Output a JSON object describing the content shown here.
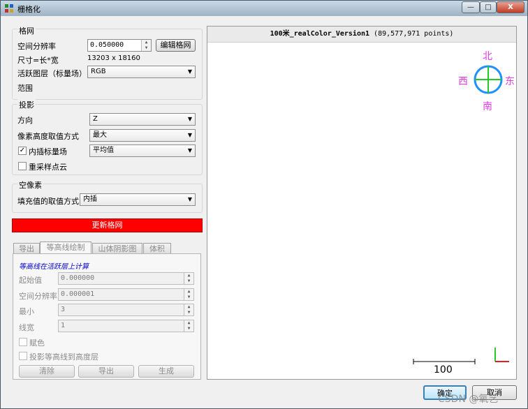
{
  "window": {
    "title": "栅格化",
    "minimize_label": "—",
    "maximize_label": "□",
    "close_label": "X"
  },
  "grid_group": {
    "title": "格网",
    "resolution_label": "空间分辨率",
    "resolution_value": "0.050000",
    "edit_grid_button": "编辑格网",
    "size_label": "尺寸=长*宽",
    "size_value": "13203 x 18160",
    "active_layer_label": "活跃图层（标量场）",
    "active_layer_value": "RGB",
    "range_label": "范围"
  },
  "projection_group": {
    "title": "投影",
    "direction_label": "方向",
    "direction_value": "Z",
    "cell_height_label": "像素高度取值方式",
    "cell_height_value": "最大",
    "interp_sf_label": "内插标量场",
    "interp_sf_checked": true,
    "interp_sf_value": "平均值",
    "resample_label": "重采样点云",
    "resample_checked": false
  },
  "empty_group": {
    "title": "空像素",
    "fill_label": "填充值的取值方式",
    "fill_value": "内插"
  },
  "update_button": "更新格网",
  "tabs": [
    {
      "label": "导出"
    },
    {
      "label": "等高线绘制"
    },
    {
      "label": "山体阴影图"
    },
    {
      "label": "体积"
    }
  ],
  "contour": {
    "hint": "等高线在活跃层上计算",
    "start_label": "起始值",
    "start_value": "0.000000",
    "step_label": "空间分辨率",
    "step_value": "0.000001",
    "min_label": "最小",
    "min_value": "3",
    "width_label": "线宽",
    "width_value": "1",
    "color_label": "赋色",
    "project_label": "投影等高线到高度层",
    "clear_button": "清除",
    "export_button": "导出",
    "generate_button": "生成"
  },
  "view": {
    "header_name": "100米_realColor_Version1",
    "header_points": "(89,577,971 points)",
    "compass": {
      "north": "北",
      "south": "南",
      "east": "东",
      "west": "西"
    },
    "scale_label": "100"
  },
  "ok_button": "确定",
  "cancel_button": "取消",
  "watermark": "CSDN @氧艺",
  "colors": {
    "update_button_bg": "#ff0000",
    "compass_label": "#e03ce0",
    "compass_ring": "#1e90ff",
    "compass_cross": "#22cc22",
    "hint_text": "#0000cc"
  }
}
